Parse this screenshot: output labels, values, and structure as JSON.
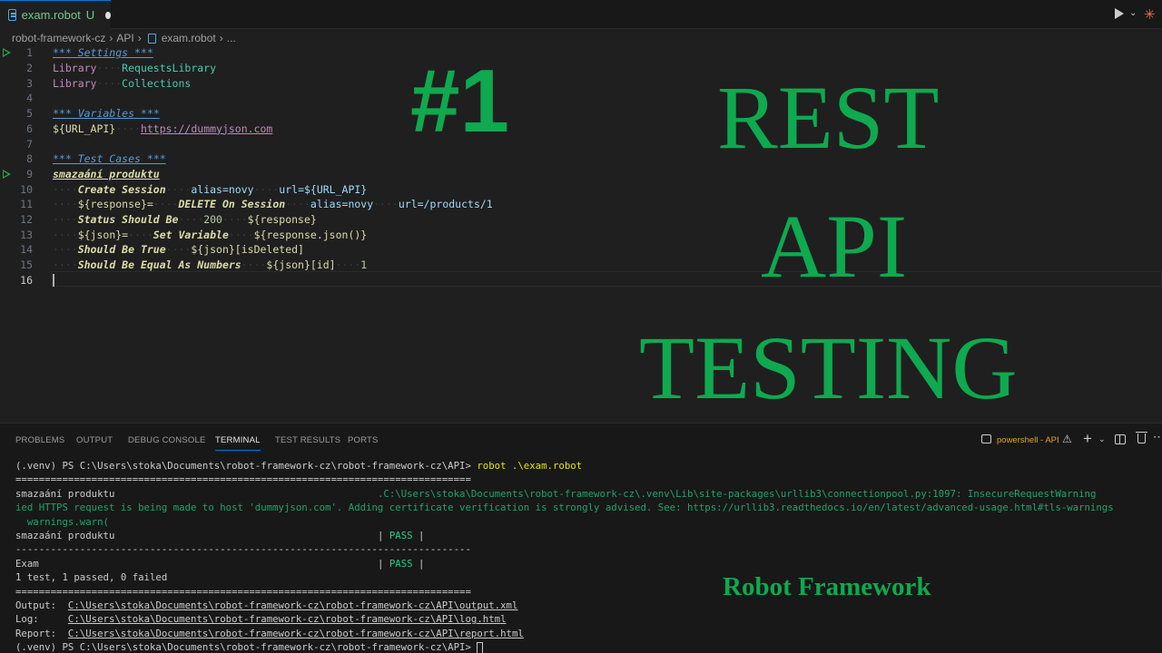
{
  "tab": {
    "name": "exam.robot",
    "badge": "U"
  },
  "breadcrumb": [
    "robot-framework-cz",
    "API",
    "exam.robot",
    "..."
  ],
  "editor": {
    "lines": [
      {
        "n": "1"
      },
      {
        "n": "2"
      },
      {
        "n": "3"
      },
      {
        "n": "4"
      },
      {
        "n": "5"
      },
      {
        "n": "6"
      },
      {
        "n": "7"
      },
      {
        "n": "8"
      },
      {
        "n": "9"
      },
      {
        "n": "10"
      },
      {
        "n": "11"
      },
      {
        "n": "12"
      },
      {
        "n": "13"
      },
      {
        "n": "14"
      },
      {
        "n": "15"
      },
      {
        "n": "16"
      }
    ],
    "settings_header": "*** Settings ***",
    "library_kw": "Library",
    "requests_library": "RequestsLibrary",
    "collections_library": "Collections",
    "variables_header": "*** Variables ***",
    "url_var": "${URL_API}",
    "url_value": "https://dummyjson.com",
    "testcases_header": "*** Test Cases ***",
    "testcase_name": "smazaání produktu",
    "l10_kw": "Create Session",
    "l10_a1": "alias=novy",
    "l10_a2": "url=${URL_API}",
    "l11_var": "${response}=",
    "l11_kw": "DELETE On Session",
    "l11_a1": "alias=novy",
    "l11_a2": "url=/products/1",
    "l12_kw": "Status Should Be",
    "l12_a1": "200",
    "l12_a2": "${response}",
    "l13_var": "${json}=",
    "l13_kw": "Set Variable",
    "l13_a1": "${response.json()}",
    "l14_kw": "Should Be True",
    "l14_a1": "${json}[isDeleted]",
    "l15_kw": "Should Be Equal As Numbers",
    "l15_a1": "${json}[id]",
    "l15_a2": "1"
  },
  "overlay": {
    "number": "#1",
    "rest": "REST",
    "api": "API",
    "testing": "TESTING",
    "framework": "Robot Framework"
  },
  "panel": {
    "tabs": [
      "PROBLEMS",
      "OUTPUT",
      "DEBUG CONSOLE",
      "TERMINAL",
      "TEST RESULTS",
      "PORTS"
    ],
    "active_tab": "TERMINAL",
    "terminal_name": "powershell - API"
  },
  "terminal": {
    "prompt": "(.venv) PS C:\\Users\\stoka\\Documents\\robot-framework-cz\\robot-framework-cz\\API> ",
    "command": "robot .\\exam.robot",
    "rule_eq": "==============================================================================",
    "rule_dash": "------------------------------------------------------------------------------",
    "test_name": "smazaání produktu",
    "warn_path": ".C:\\Users\\stoka\\Documents\\robot-framework-cz\\.venv\\Lib\\site-packages\\urllib3\\connectionpool.py:1097: InsecureRequestWarning",
    "warn_line": "ied HTTPS request is being made to host 'dummyjson.com'. Adding certificate verification is strongly advised. See: https://urllib3.readthedocs.io/en/latest/advanced-usage.html#tls-warnings",
    "warn_call": "  warnings.warn(",
    "pass_sep": "| ",
    "pass": "PASS",
    "pass_end": " |",
    "suite_name": "Exam",
    "summary": "1 test, 1 passed, 0 failed",
    "output_label": "Output:  ",
    "output_path": "C:\\Users\\stoka\\Documents\\robot-framework-cz\\robot-framework-cz\\API\\output.xml",
    "log_label": "Log:     ",
    "log_path": "C:\\Users\\stoka\\Documents\\robot-framework-cz\\robot-framework-cz\\API\\log.html",
    "report_label": "Report:  ",
    "report_path": "C:\\Users\\stoka\\Documents\\robot-framework-cz\\robot-framework-cz\\API\\report.html"
  }
}
